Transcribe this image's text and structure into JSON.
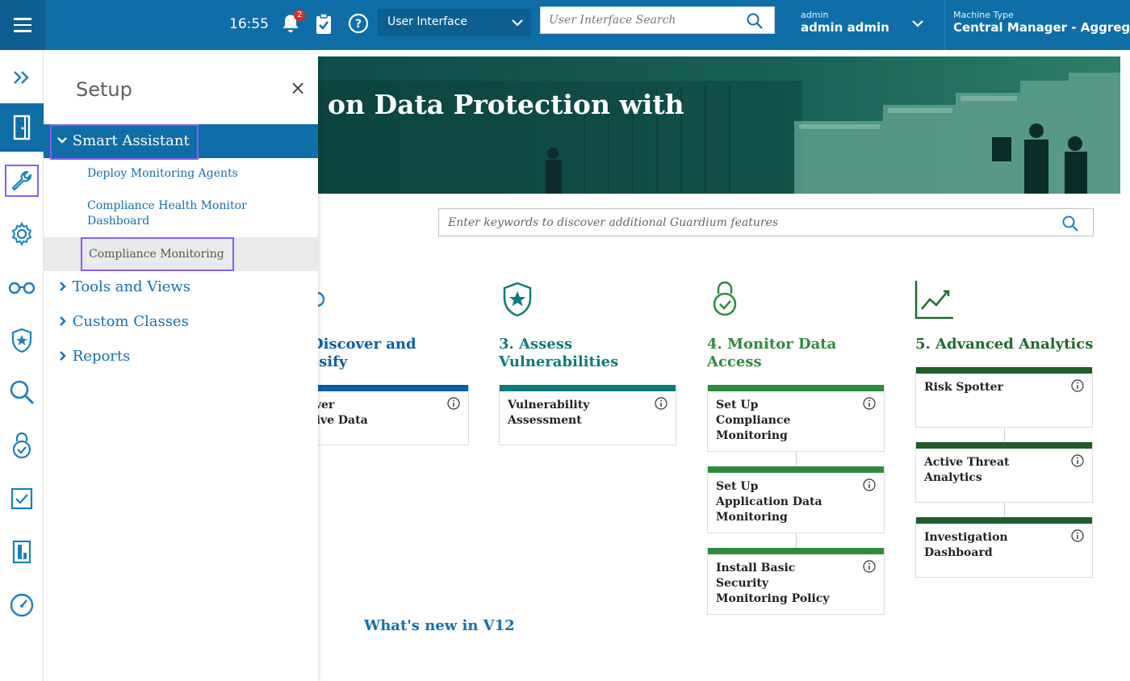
{
  "topbar": {
    "time": "16:55",
    "notification_count": "2",
    "view_select": "User Interface",
    "search_placeholder": "User Interface Search",
    "user_small": "admin",
    "user_big": "admin admin",
    "machine_small": "Machine Type",
    "machine_big": "Central Manager - Aggregator"
  },
  "rail": {
    "icons": [
      "expand-icon",
      "door-icon",
      "wrench-icon",
      "gear-icon",
      "glasses-icon",
      "shield-star-icon",
      "search-icon",
      "lock-check-icon",
      "checklist-icon",
      "report-icon",
      "gauge-icon"
    ]
  },
  "drawer": {
    "title": "Setup",
    "close": "×",
    "smart_assistant": "Smart Assistant",
    "sub_items": [
      "Deploy Monitoring Agents",
      "Compliance Health Monitor Dashboard",
      "Compliance Monitoring"
    ],
    "sections": [
      "Tools and Views",
      "Custom Classes",
      "Reports"
    ]
  },
  "hero": {
    "title": "on Data Protection with"
  },
  "main_search": {
    "placeholder": "Enter keywords to discover additional Guardium features"
  },
  "columns": [
    {
      "heading": "Discover and ssify",
      "heading_line1": "Discover and",
      "heading_line2": "ssify",
      "color": "#0a5ea8",
      "cards": [
        {
          "line1": "cover",
          "line2": "sitive Data"
        }
      ]
    },
    {
      "heading_line1": "3. Assess",
      "heading_line2": "Vulnerabilities",
      "color": "#0f7a7a",
      "cards": [
        {
          "line1": "Vulnerability",
          "line2": "Assessment"
        }
      ]
    },
    {
      "heading_line1": "4. Monitor Data",
      "heading_line2": "Access",
      "color": "#2e8b3e",
      "cards": [
        {
          "line1": "Set Up",
          "line2": "Compliance",
          "line3": "Monitoring"
        },
        {
          "line1": "Set Up",
          "line2": "Application Data",
          "line3": "Monitoring"
        },
        {
          "line1": "Install Basic",
          "line2": "Security",
          "line3": "Monitoring Policy"
        }
      ]
    },
    {
      "heading_line1": "5. Advanced Analytics",
      "color": "#1e6b2e",
      "cards": [
        {
          "line1": "Risk Spotter"
        },
        {
          "line1": "Active Threat",
          "line2": "Analytics"
        },
        {
          "line1": "Investigation",
          "line2": "Dashboard"
        }
      ]
    }
  ],
  "whats_new": "What's new in V12"
}
